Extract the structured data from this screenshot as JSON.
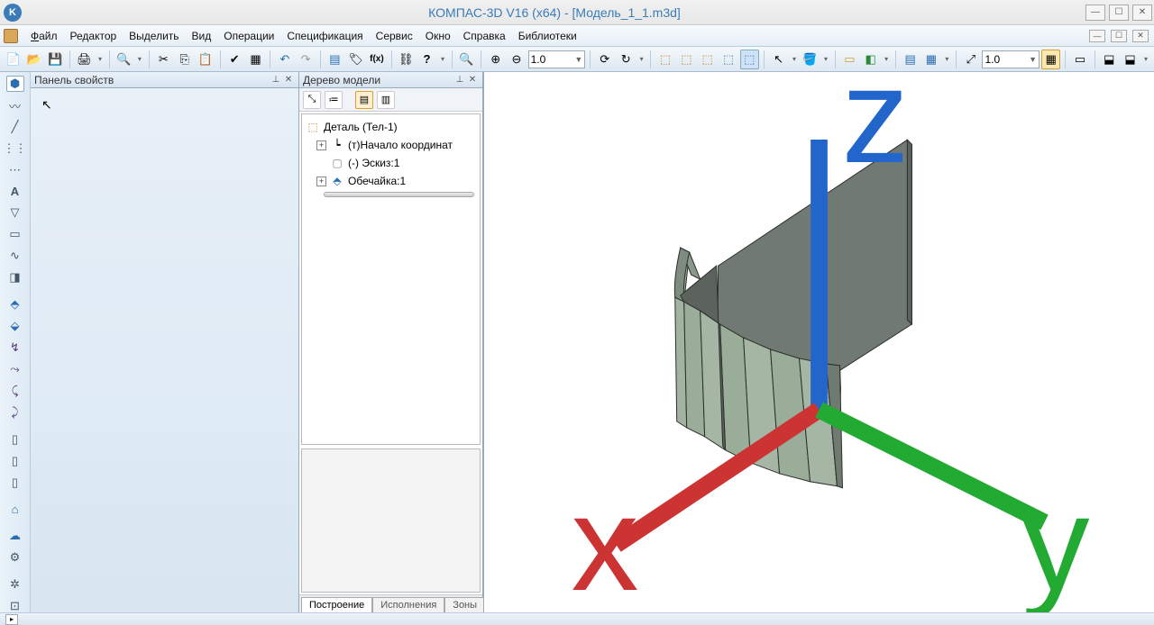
{
  "title": "КОМПАС-3D V16  (x64) - [Модель_1_1.m3d]",
  "menu": {
    "file": "Файл",
    "editor": "Редактор",
    "select": "Выделить",
    "view": "Вид",
    "operations": "Операции",
    "spec": "Спецификация",
    "service": "Сервис",
    "window": "Окно",
    "help": "Справка",
    "libs": "Библиотеки"
  },
  "toolbar": {
    "zoom_value": "1.0",
    "scale_value": "1.0"
  },
  "panels": {
    "props_title": "Панель свойств",
    "tree_title": "Дерево модели"
  },
  "tree": {
    "root": "Деталь (Тел-1)",
    "origin": "(т)Начало координат",
    "sketch": "(-) Эскиз:1",
    "shell": "Обечайка:1"
  },
  "tabs": {
    "build": "Построение",
    "exec": "Исполнения",
    "zones": "Зоны"
  }
}
